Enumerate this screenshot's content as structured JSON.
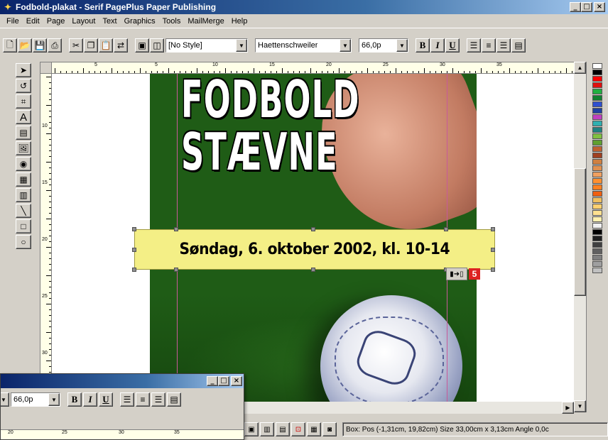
{
  "window": {
    "title": "Fodbold-plakat - Serif PagePlus Paper Publishing",
    "icon": "pageplus-app-icon",
    "minimize": "_",
    "maximize": "□",
    "close": "×"
  },
  "menu": {
    "items": [
      {
        "label": "File"
      },
      {
        "label": "Edit"
      },
      {
        "label": "Page"
      },
      {
        "label": "Layout"
      },
      {
        "label": "Text"
      },
      {
        "label": "Graphics"
      },
      {
        "label": "Tools"
      },
      {
        "label": "MailMerge"
      },
      {
        "label": "Help"
      }
    ]
  },
  "toolbar": {
    "style_value": "[No Style]",
    "font_value": "Haettenschweiler",
    "size_value": "66,0p",
    "bold": "B",
    "italic": "I",
    "underline": "U",
    "icons": [
      "new-icon",
      "open-icon",
      "save-icon",
      "print-icon",
      "cut-icon",
      "copy-icon",
      "paste-icon",
      "replicate-icon",
      "bring-front-icon",
      "send-back-icon"
    ]
  },
  "ruler": {
    "h_labels": [
      "5",
      "5",
      "10",
      "15",
      "20",
      "25",
      "30",
      "35"
    ],
    "v_labels": [
      "10",
      "15",
      "20",
      "25",
      "30"
    ]
  },
  "poster": {
    "headline_line1": "FODBOLD",
    "headline_line2": "STÆVNE",
    "date_text": "Søndag, 6. oktober 2002, kl. 10-14",
    "link_badge": "5"
  },
  "status": {
    "text": "Box: Pos (-1,31cm, 19,82cm) Size 33,00cm x 3,13cm  Angle 0,0c"
  },
  "second_window": {
    "size_value": "66,0p",
    "bold": "B",
    "italic": "I",
    "underline": "U",
    "ruler_labels": [
      "20",
      "25",
      "30",
      "35"
    ]
  },
  "palette": {
    "colors": [
      "#ffffff",
      "#000000",
      "#ff0000",
      "#e01010",
      "#20b040",
      "#108030",
      "#3050d0",
      "#2040a0",
      "#c040c0",
      "#30b0b0",
      "#208080",
      "#80c040",
      "#60a030",
      "#c06030",
      "#a04020",
      "#d08040",
      "#e09050",
      "#f0a060",
      "#ff9030",
      "#ff8020",
      "#f06010",
      "#f0c060",
      "#ffd070",
      "#ffe090",
      "#fff0b0",
      "#f0f0f0",
      "#000000",
      "#202020",
      "#404040",
      "#606060",
      "#808080",
      "#a0a0a0",
      "#c0c0c0"
    ]
  }
}
